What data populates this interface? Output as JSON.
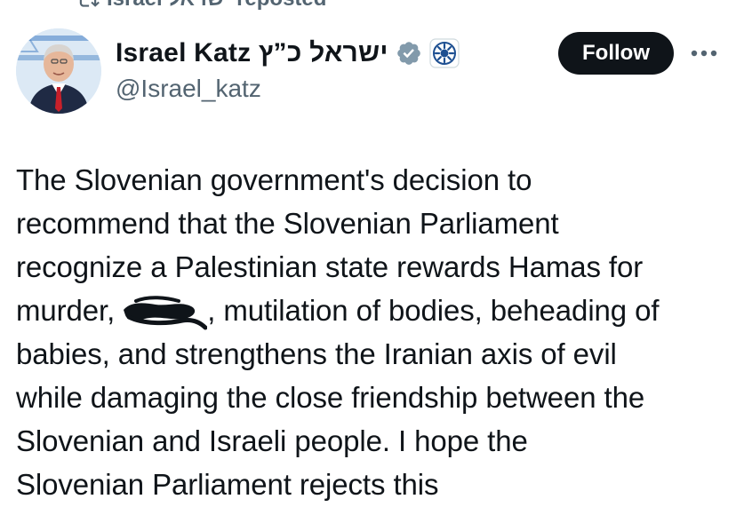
{
  "repost": {
    "icon": "repost-icon",
    "text": "Israel ישראל reposted"
  },
  "author": {
    "display_name": "Israel Katz ישראל כ”ץ",
    "handle": "@Israel_katz",
    "verified_icon": "verified-badge-icon",
    "affiliation_icon": "government-org-badge-icon",
    "avatar_icon": "profile-photo"
  },
  "actions": {
    "follow_label": "Follow",
    "more_icon": "more-options-icon"
  },
  "colors": {
    "text_primary": "#0f1419",
    "text_secondary": "#536471",
    "verified_badge": "#829aab",
    "follow_button_bg": "#0f1419",
    "follow_button_text": "#ffffff"
  },
  "tweet": {
    "line1": "The Slovenian government's decision to",
    "line2": "recommend that the Slovenian Parliament",
    "line3": "recognize a Palestinian state rewards Hamas for",
    "line4_before": "murder,",
    "line4_after": ", mutilation of bodies, beheading of",
    "line5": "babies, and strengthens the Iranian axis of evil",
    "line6": "while damaging the close friendship between the",
    "line7": "Slovenian and Israeli people. I hope the",
    "line8": "Slovenian Parliament rejects this",
    "redaction_icon": "redaction-scribble"
  }
}
